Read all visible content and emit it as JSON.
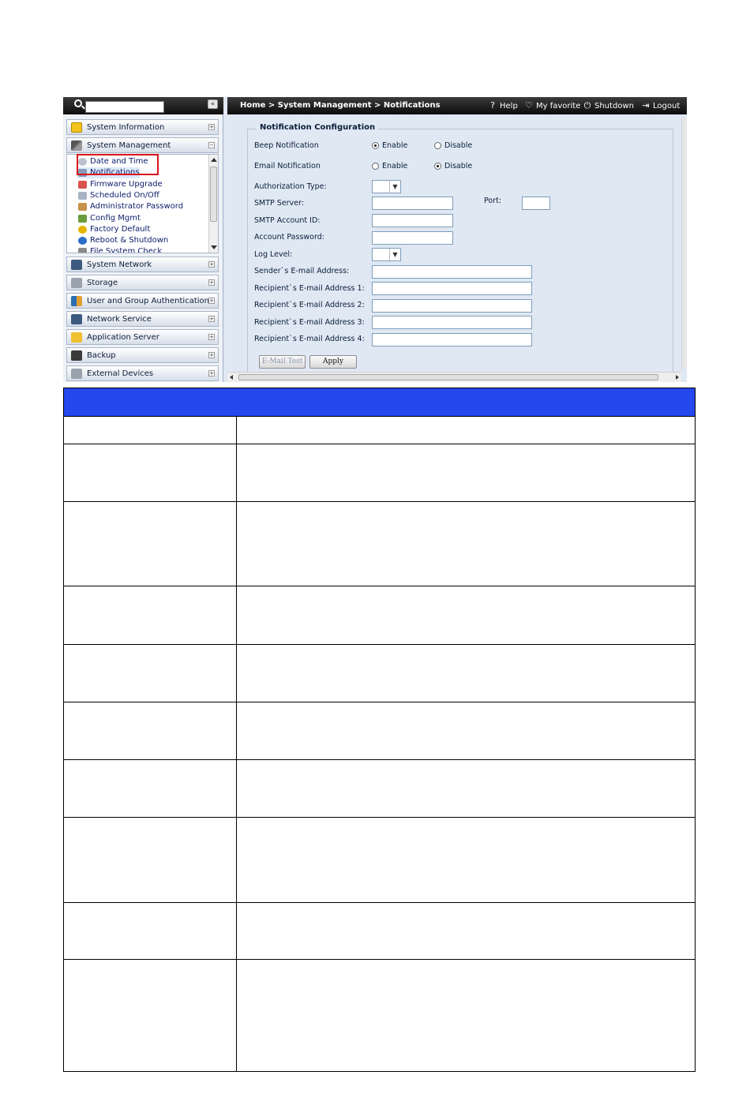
{
  "sidebar": {
    "search_placeholder": "",
    "collapse_label": "«",
    "top_sections": [
      {
        "label": "System Information",
        "toggle": "+"
      },
      {
        "label": "System Management",
        "toggle": "−"
      }
    ],
    "submenu_items": [
      {
        "label": "Date and Time"
      },
      {
        "label": "Notifications"
      },
      {
        "label": "Firmware Upgrade"
      },
      {
        "label": "Scheduled On/Off"
      },
      {
        "label": "Administrator Password"
      },
      {
        "label": "Config Mgmt"
      },
      {
        "label": "Factory Default"
      },
      {
        "label": "Reboot & Shutdown"
      },
      {
        "label": "File System Check"
      }
    ],
    "bottom_sections": [
      {
        "label": "System Network",
        "toggle": "+"
      },
      {
        "label": "Storage",
        "toggle": "+"
      },
      {
        "label": "User and Group Authentication",
        "toggle": "+"
      },
      {
        "label": "Network Service",
        "toggle": "+"
      },
      {
        "label": "Application Server",
        "toggle": "+"
      },
      {
        "label": "Backup",
        "toggle": "+"
      },
      {
        "label": "External Devices",
        "toggle": "+"
      }
    ]
  },
  "topbar": {
    "breadcrumb": "Home > System Management > Notifications",
    "help": "Help",
    "favorite": "My favorite",
    "shutdown": "Shutdown",
    "logout": "Logout"
  },
  "form": {
    "legend": "Notification Configuration",
    "beep_label": "Beep Notification",
    "beep_enable": "Enable",
    "beep_disable": "Disable",
    "beep_selected": "Enable",
    "email_label": "Email Notification",
    "email_enable": "Enable",
    "email_disable": "Disable",
    "email_selected": "Disable",
    "auth_type_label": "Authorization Type:",
    "smtp_server_label": "SMTP Server:",
    "port_label": "Port:",
    "smtp_account_label": "SMTP Account ID:",
    "account_password_label": "Account Password:",
    "log_level_label": "Log Level:",
    "sender_label": "Sender`s E-mail Address:",
    "recipient1_label": "Recipient`s E-mail Address 1:",
    "recipient2_label": "Recipient`s E-mail Address 2:",
    "recipient3_label": "Recipient`s E-mail Address 3:",
    "recipient4_label": "Recipient`s E-mail Address 4:",
    "email_test_button": "E-Mail Test",
    "apply_button": "Apply"
  },
  "colors": {
    "table_header": "#2447ee",
    "highlight_box": "#d8161b"
  }
}
